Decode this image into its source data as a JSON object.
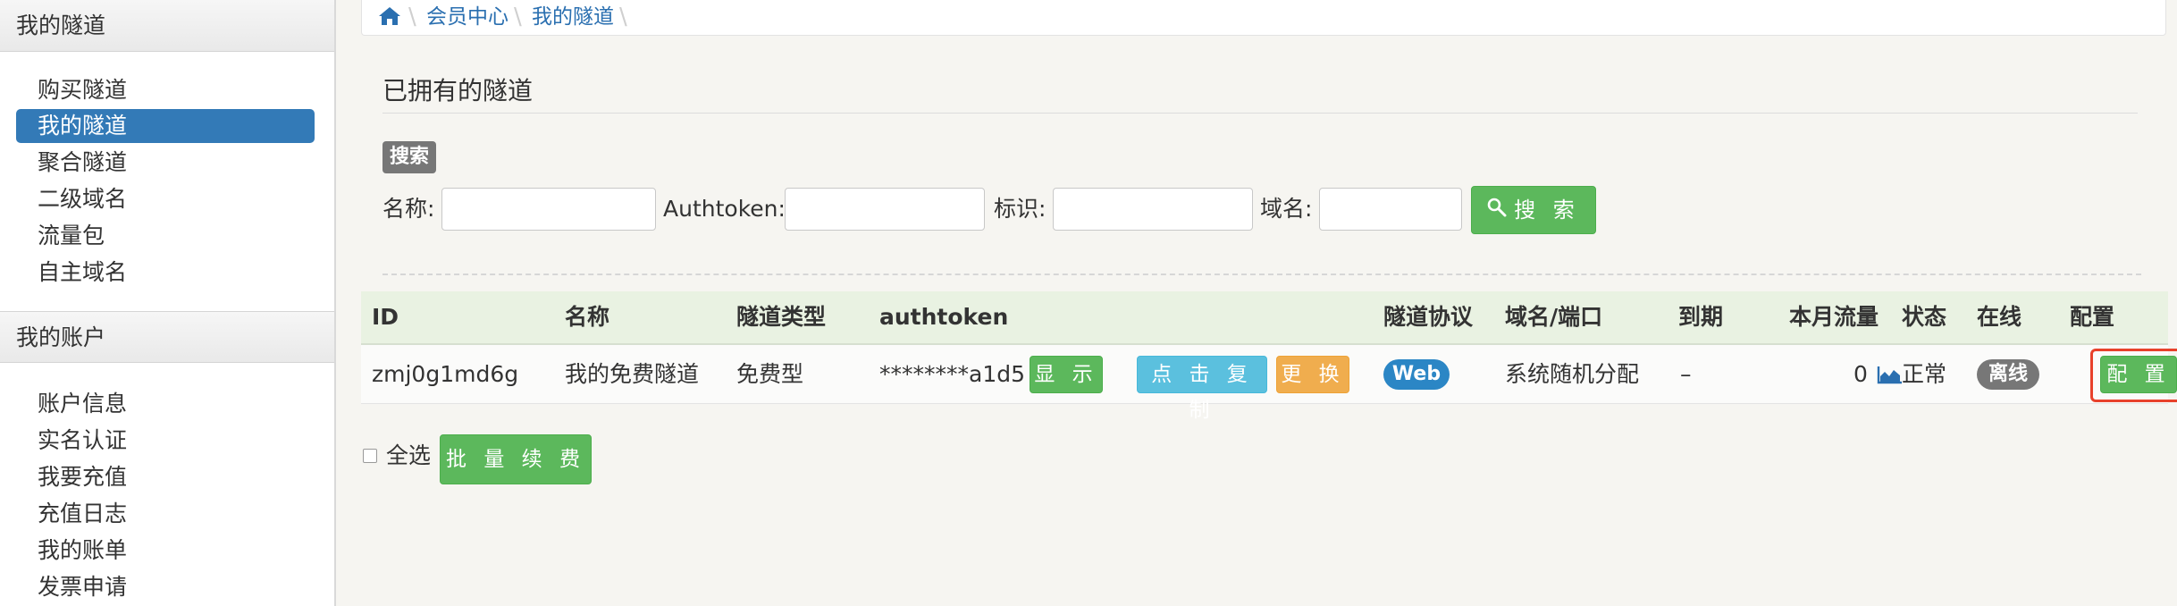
{
  "sidebar": {
    "groups": [
      {
        "title": "我的隧道",
        "items": [
          {
            "label": "购买隧道"
          },
          {
            "label": "我的隧道"
          },
          {
            "label": "聚合隧道"
          },
          {
            "label": "二级域名"
          },
          {
            "label": "流量包"
          },
          {
            "label": "自主域名"
          }
        ]
      },
      {
        "title": "我的账户",
        "items": [
          {
            "label": "账户信息"
          },
          {
            "label": "实名认证"
          },
          {
            "label": "我要充值"
          },
          {
            "label": "充值日志"
          },
          {
            "label": "我的账单"
          },
          {
            "label": "发票申请"
          }
        ]
      }
    ]
  },
  "breadcrumb": {
    "icon": "home-icon",
    "items": [
      "会员中心",
      "我的隧道"
    ]
  },
  "section": {
    "title": "已拥有的隧道",
    "search_badge": "搜索"
  },
  "search": {
    "name_label": "名称:",
    "authtoken_label": "Authtoken:",
    "tag_label": "标识:",
    "domain_label": "域名:",
    "button": "搜 索"
  },
  "table": {
    "headers": [
      "ID",
      "名称",
      "隧道类型",
      "authtoken",
      "隧道协议",
      "域名/端口",
      "到期",
      "本月流量",
      "状态",
      "在线",
      "配置"
    ],
    "rows": [
      {
        "id": "zmj0g1md6g",
        "name": "我的免费隧道",
        "type": "免费型",
        "authtoken": "********a1d5",
        "show_btn": "显 示",
        "copy_btn": "点 击 复 制",
        "change_btn": "更 换",
        "protocol": "Web",
        "domain": "系统随机分配",
        "expire": "–",
        "traffic": "0",
        "status": "正常",
        "online": "离线",
        "config_btn": "配 置"
      }
    ]
  },
  "footer": {
    "select_all": "全选",
    "batch_renew": "批 量 续 费"
  },
  "colors": {
    "primary": "#337ab7",
    "success": "#5cb85c",
    "info": "#5bc0de",
    "warning": "#f0ad4e",
    "highlight": "#e8412b"
  }
}
